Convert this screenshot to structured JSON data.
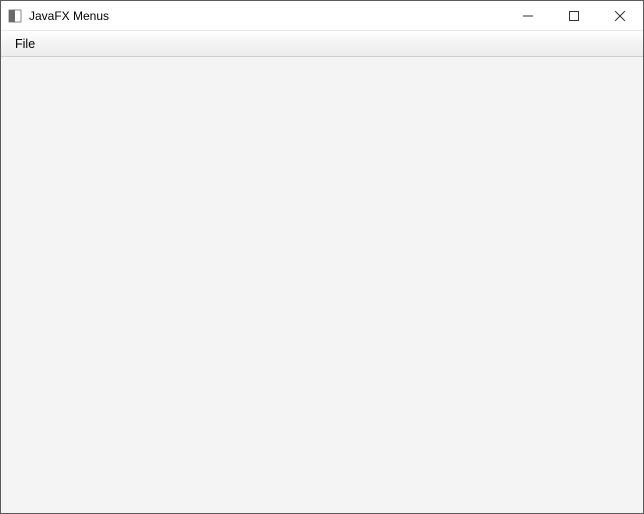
{
  "window": {
    "title": "JavaFX Menus"
  },
  "menubar": {
    "items": [
      {
        "label": "File"
      }
    ]
  }
}
